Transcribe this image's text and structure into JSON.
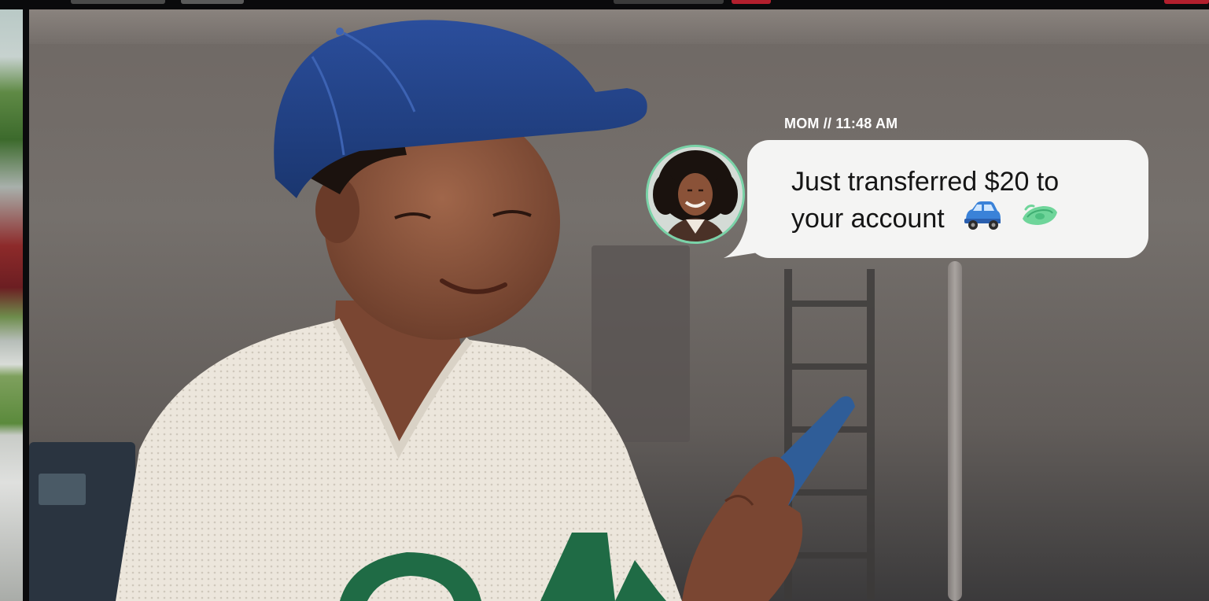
{
  "message": {
    "sender": "MOM",
    "separator": "//",
    "time": "11:48 AM",
    "label": "MOM // 11:48 AM",
    "line1": "Just transferred $20 to",
    "line2": "your account",
    "emojis": [
      "car-icon",
      "money-icon"
    ]
  },
  "colors": {
    "bubble": "#f4f4f3",
    "avatar_ring": "#7ad3a8",
    "cap": "#1f3f86",
    "jersey": "#ede7dd",
    "jersey_numbers": "#1f6b45",
    "phone": "#2f5d98"
  }
}
